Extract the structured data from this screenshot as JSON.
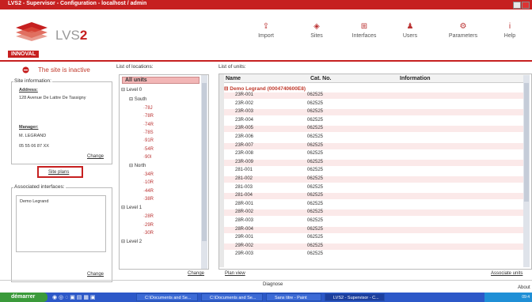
{
  "window": {
    "title": "LVS2 - Supervisor - Configuration - localhost / admin"
  },
  "brand": {
    "logo_lvs": "LVS",
    "logo_2": "2",
    "tab": "INNOVAL"
  },
  "nav": [
    {
      "label": "Import",
      "icon": "import-icon"
    },
    {
      "label": "Sites",
      "icon": "sites-icon"
    },
    {
      "label": "Interfaces",
      "icon": "interfaces-icon"
    },
    {
      "label": "Users",
      "icon": "users-icon"
    },
    {
      "label": "Parameters",
      "icon": "parameters-icon"
    },
    {
      "label": "Help",
      "icon": "help-icon"
    }
  ],
  "site": {
    "status": "The site is inactive",
    "info_title": "Site information:",
    "address_label": "Address:",
    "address_value": "128 Avenue De Lattre De Tassigny",
    "manager_label": "Manager:",
    "manager_name": "M. LEGRAND",
    "manager_phone": "05 55 06 87 XX",
    "change": "Change",
    "site_plans": "Site plans",
    "interfaces_title": "Associated interfaces:",
    "interface_item": "Demo Legrand",
    "interfaces_change": "Change"
  },
  "locations": {
    "title": "List of locations:",
    "all_units": "All units",
    "items": [
      {
        "label": "Level 0",
        "type": "node"
      },
      {
        "label": "South",
        "type": "node"
      },
      {
        "label": "78J",
        "type": "leaf"
      },
      {
        "label": "78R",
        "type": "leaf"
      },
      {
        "label": "74R",
        "type": "leaf"
      },
      {
        "label": "78S",
        "type": "leaf"
      },
      {
        "label": "91R",
        "type": "leaf"
      },
      {
        "label": "54R",
        "type": "leaf"
      },
      {
        "label": "90I",
        "type": "leaf"
      },
      {
        "label": "North",
        "type": "node"
      },
      {
        "label": "34R",
        "type": "leaf"
      },
      {
        "label": "10R",
        "type": "leaf"
      },
      {
        "label": "44R",
        "type": "leaf"
      },
      {
        "label": "38R",
        "type": "leaf"
      },
      {
        "label": "Level 1",
        "type": "node"
      },
      {
        "label": "28R",
        "type": "leaf"
      },
      {
        "label": "29R",
        "type": "leaf"
      },
      {
        "label": "30R",
        "type": "leaf"
      },
      {
        "label": "Level 2",
        "type": "node"
      }
    ],
    "change": "Change"
  },
  "units": {
    "title": "List of units:",
    "columns": [
      "Name",
      "Cat. No.",
      "Information"
    ],
    "group": "Demo Legrand (0004740600E8)",
    "rows": [
      {
        "name": "23R-001",
        "cat": "062525"
      },
      {
        "name": "23R-002",
        "cat": "062525"
      },
      {
        "name": "23R-003",
        "cat": "062525"
      },
      {
        "name": "23R-004",
        "cat": "062525"
      },
      {
        "name": "23R-005",
        "cat": "062525"
      },
      {
        "name": "23R-006",
        "cat": "062525"
      },
      {
        "name": "23R-007",
        "cat": "062525"
      },
      {
        "name": "23R-008",
        "cat": "062525"
      },
      {
        "name": "23R-009",
        "cat": "062525"
      },
      {
        "name": "281-001",
        "cat": "062525"
      },
      {
        "name": "281-002",
        "cat": "062525"
      },
      {
        "name": "281-003",
        "cat": "062525"
      },
      {
        "name": "281-004",
        "cat": "062525"
      },
      {
        "name": "28R-001",
        "cat": "062525"
      },
      {
        "name": "28R-002",
        "cat": "062525"
      },
      {
        "name": "28R-003",
        "cat": "062525"
      },
      {
        "name": "28R-004",
        "cat": "062525"
      },
      {
        "name": "29R-001",
        "cat": "062525"
      },
      {
        "name": "29R-002",
        "cat": "062525"
      },
      {
        "name": "29R-003",
        "cat": "062525"
      }
    ],
    "plan_view": "Plan view",
    "associate": "Associate units"
  },
  "footer": {
    "center": "Diagnose",
    "right": "About"
  },
  "taskbar": {
    "start": "démarrer",
    "items": [
      "C:\\Documents and Se...",
      "C:\\Documents and Se...",
      "Sans titre - Paint",
      "LVS2 - Supervisor - C..."
    ],
    "clock": "09:4"
  }
}
